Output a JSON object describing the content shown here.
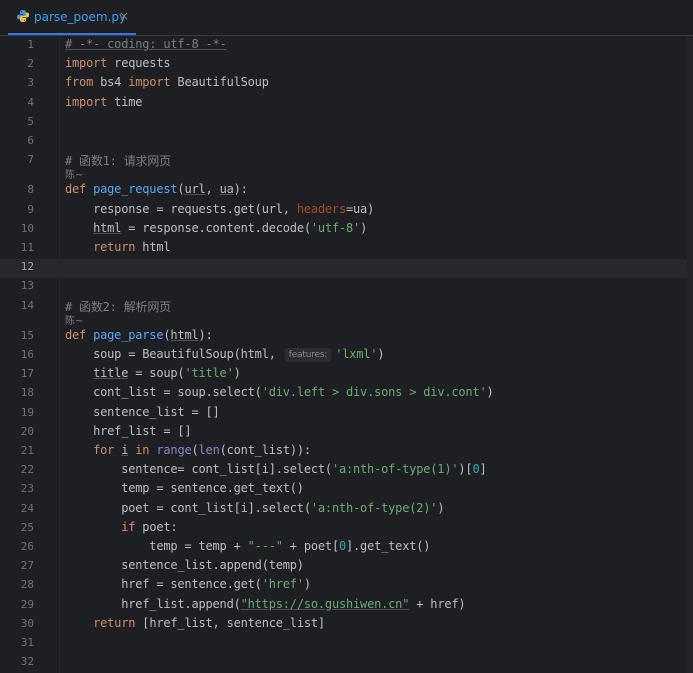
{
  "tab": {
    "filename": "parse_poem.py",
    "close": "×"
  },
  "current_line": "12",
  "hints": {
    "author": "陈~"
  },
  "lines": [
    {
      "no": "1",
      "t": [
        [
          "# -*- coding: utf-8 -*-",
          "cmt u"
        ]
      ]
    },
    {
      "no": "2",
      "t": [
        [
          "import",
          "kw"
        ],
        [
          " requests",
          ""
        ]
      ]
    },
    {
      "no": "3",
      "t": [
        [
          "from",
          "kw"
        ],
        [
          " bs4 ",
          ""
        ],
        [
          "import",
          "kw"
        ],
        [
          " BeautifulSoup",
          ""
        ]
      ]
    },
    {
      "no": "4",
      "t": [
        [
          "import",
          "kw"
        ],
        [
          " time",
          ""
        ]
      ]
    },
    {
      "no": "5",
      "t": []
    },
    {
      "no": "6",
      "t": []
    },
    {
      "no": "7",
      "t": [
        [
          "# 函数1: 请求网页",
          "cmt"
        ]
      ],
      "hint": true
    },
    {
      "no": "8",
      "t": [
        [
          "def",
          "kw"
        ],
        [
          " ",
          ""
        ],
        [
          "page_request",
          "fn"
        ],
        [
          "(",
          ""
        ],
        [
          "url",
          "u"
        ],
        [
          ", ",
          ""
        ],
        [
          "ua",
          "u"
        ],
        [
          "):",
          ""
        ]
      ]
    },
    {
      "no": "9",
      "t": [
        [
          "    response = requests.get(url, ",
          ""
        ],
        [
          "headers",
          "param"
        ],
        [
          "=ua)",
          ""
        ]
      ]
    },
    {
      "no": "10",
      "t": [
        [
          "    ",
          ""
        ],
        [
          "html",
          "u"
        ],
        [
          " = response.content.decode(",
          ""
        ],
        [
          "'utf-8'",
          "str"
        ],
        [
          ")",
          ""
        ]
      ]
    },
    {
      "no": "11",
      "t": [
        [
          "    ",
          ""
        ],
        [
          "return",
          "kw"
        ],
        [
          " html",
          ""
        ]
      ]
    },
    {
      "no": "12",
      "t": []
    },
    {
      "no": "13",
      "t": []
    },
    {
      "no": "14",
      "t": [
        [
          "# 函数2: 解析网页",
          "cmt"
        ]
      ],
      "hint": true
    },
    {
      "no": "15",
      "t": [
        [
          "def",
          "kw"
        ],
        [
          " ",
          ""
        ],
        [
          "page_parse",
          "fn"
        ],
        [
          "(",
          ""
        ],
        [
          "html",
          "u"
        ],
        [
          "):",
          ""
        ]
      ]
    },
    {
      "no": "16",
      "t": [
        [
          "    soup = BeautifulSoup(html, ",
          ""
        ],
        [
          "features:",
          "inlay"
        ],
        [
          "'lxml'",
          "str"
        ],
        [
          ")",
          ""
        ]
      ]
    },
    {
      "no": "17",
      "t": [
        [
          "    ",
          ""
        ],
        [
          "title",
          "u"
        ],
        [
          " = soup(",
          ""
        ],
        [
          "'title'",
          "str"
        ],
        [
          ")",
          ""
        ]
      ]
    },
    {
      "no": "18",
      "t": [
        [
          "    cont_list = soup.select(",
          ""
        ],
        [
          "'div.left > div.sons > div.cont'",
          "str"
        ],
        [
          ")",
          ""
        ]
      ]
    },
    {
      "no": "19",
      "t": [
        [
          "    sentence_list = []",
          ""
        ]
      ]
    },
    {
      "no": "20",
      "t": [
        [
          "    href_list = []",
          ""
        ]
      ]
    },
    {
      "no": "21",
      "t": [
        [
          "    ",
          ""
        ],
        [
          "for",
          "kw"
        ],
        [
          " ",
          ""
        ],
        [
          "i",
          "u"
        ],
        [
          " ",
          ""
        ],
        [
          "in",
          "kw"
        ],
        [
          " ",
          ""
        ],
        [
          "range",
          "bi"
        ],
        [
          "(",
          ""
        ],
        [
          "len",
          "bi"
        ],
        [
          "(cont_list)):",
          ""
        ]
      ]
    },
    {
      "no": "22",
      "t": [
        [
          "        sentence= cont_list[i].select(",
          ""
        ],
        [
          "'a:nth-of-type(1)'",
          "str"
        ],
        [
          ")[",
          ""
        ],
        [
          "0",
          "num"
        ],
        [
          "]",
          ""
        ]
      ]
    },
    {
      "no": "23",
      "t": [
        [
          "        temp = sentence.get_text()",
          ""
        ]
      ]
    },
    {
      "no": "24",
      "t": [
        [
          "        poet = cont_list[i].select(",
          ""
        ],
        [
          "'a:nth-of-type(2)'",
          "str"
        ],
        [
          ")",
          ""
        ]
      ]
    },
    {
      "no": "25",
      "t": [
        [
          "        ",
          ""
        ],
        [
          "if",
          "kw"
        ],
        [
          " poet:",
          ""
        ]
      ]
    },
    {
      "no": "26",
      "t": [
        [
          "            temp = temp + ",
          ""
        ],
        [
          "\"---\"",
          "str"
        ],
        [
          " + poet[",
          ""
        ],
        [
          "0",
          "num"
        ],
        [
          "].get_text()",
          ""
        ]
      ]
    },
    {
      "no": "27",
      "t": [
        [
          "        sentence_list.append(temp)",
          ""
        ]
      ]
    },
    {
      "no": "28",
      "t": [
        [
          "        href = sentence.get(",
          ""
        ],
        [
          "'href'",
          "str"
        ],
        [
          ")",
          ""
        ]
      ]
    },
    {
      "no": "29",
      "t": [
        [
          "        href_list.append(",
          ""
        ],
        [
          "\"https://so.gushiwen.cn\"",
          "str u"
        ],
        [
          " + href)",
          ""
        ]
      ]
    },
    {
      "no": "30",
      "t": [
        [
          "    ",
          ""
        ],
        [
          "return",
          "kw"
        ],
        [
          " [href_list, sentence_list]",
          ""
        ]
      ]
    },
    {
      "no": "31",
      "t": []
    },
    {
      "no": "32",
      "t": []
    }
  ]
}
